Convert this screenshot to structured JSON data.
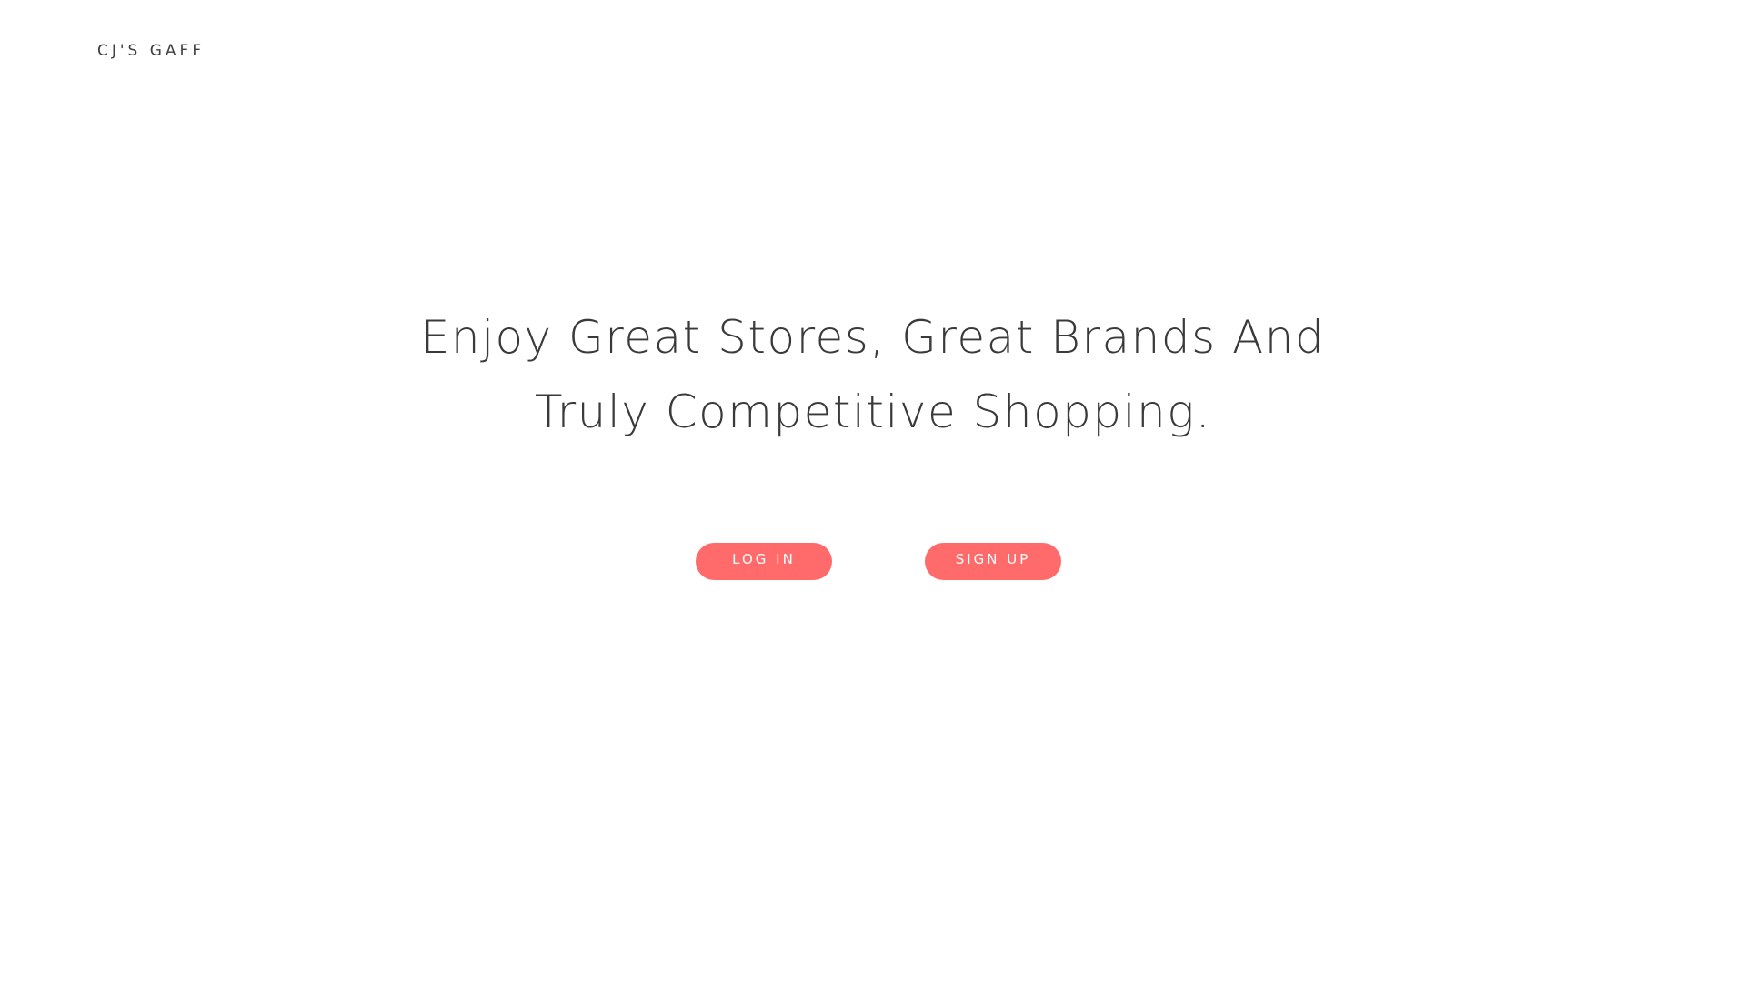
{
  "header": {
    "brand": "CJ'S GAFF"
  },
  "hero": {
    "headline_line1": "Enjoy Great Stores, Great Brands And",
    "headline_line2": "Truly Competitive Shopping."
  },
  "actions": {
    "login_label": "LOG IN",
    "signup_label": "SIGN UP"
  },
  "colors": {
    "accent": "#ff6b6b",
    "text": "#3a3a3a",
    "background": "#ffffff"
  }
}
